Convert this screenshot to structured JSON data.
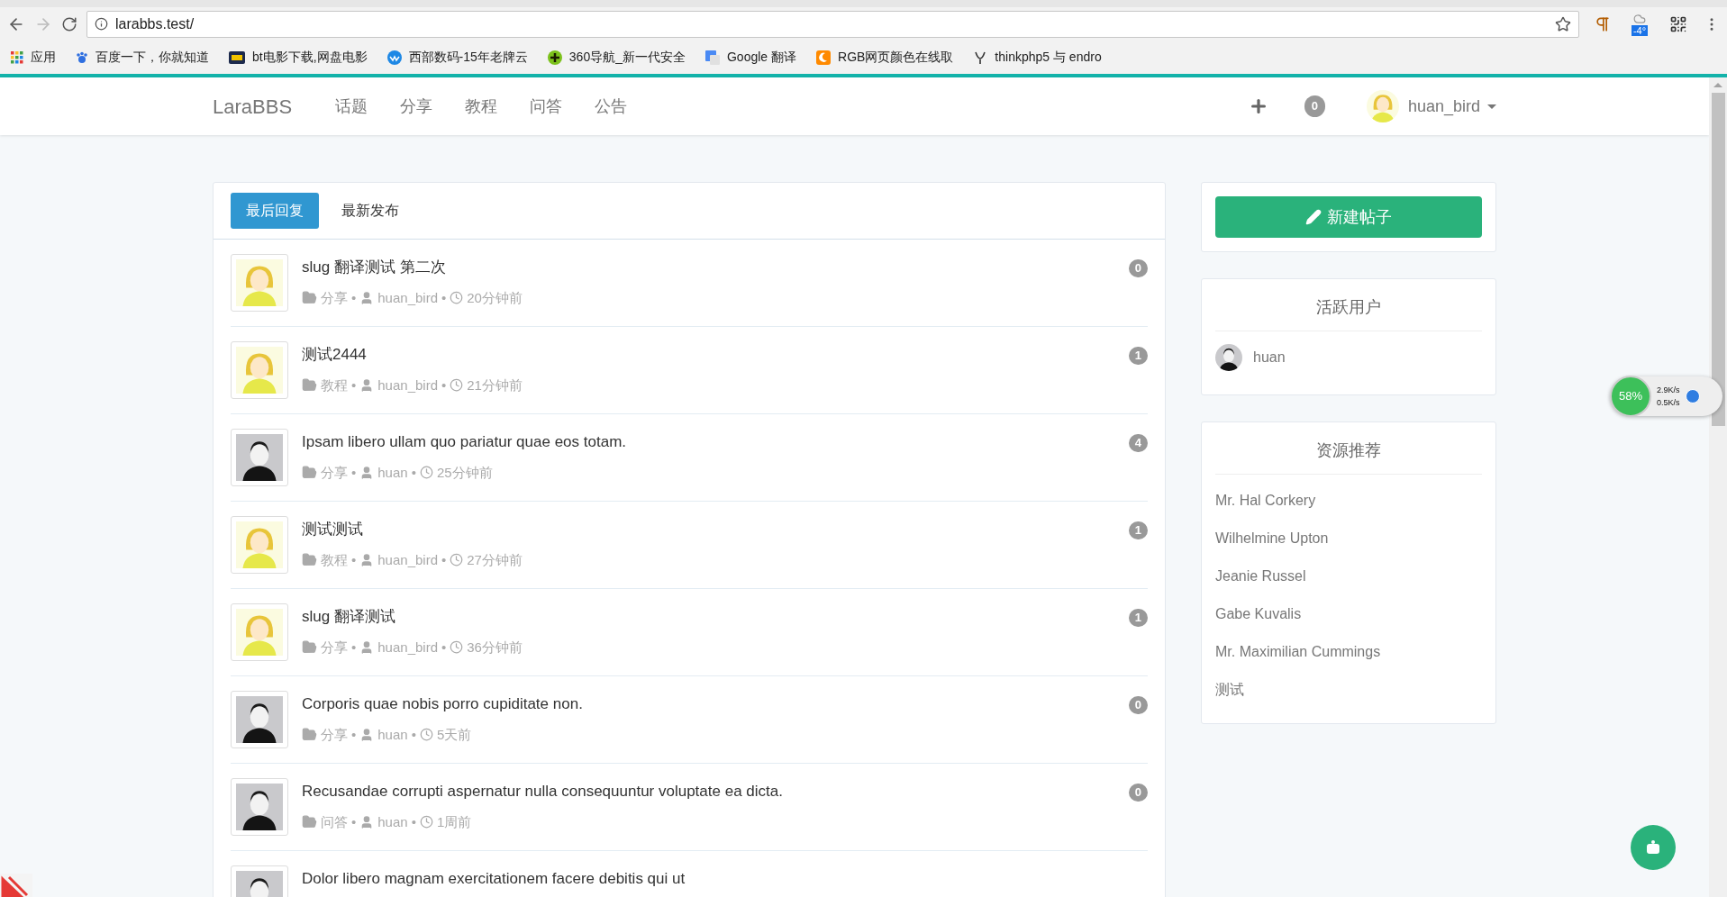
{
  "browser": {
    "address": "larabbs.test/",
    "weather": "-4°",
    "bookmarks": [
      "应用",
      "百度一下，你就知道",
      "bt电影下载,网盘电影",
      "西部数码-15年老牌云",
      "360导航_新一代安全",
      "Google 翻译",
      "RGB网页颜色在线取",
      "thinkphp5 与 endro"
    ]
  },
  "navbar": {
    "brand": "LaraBBS",
    "links": [
      "话题",
      "分享",
      "教程",
      "问答",
      "公告"
    ],
    "notifications": "0",
    "user": "huan_bird"
  },
  "tabs": [
    {
      "label": "最后回复",
      "selected": true
    },
    {
      "label": "最新发布",
      "selected": false
    }
  ],
  "topics": [
    {
      "title": "slug 翻译测试 第二次",
      "category": "分享",
      "author": "huan_bird",
      "time": "20分钟前",
      "replies": "0",
      "kind": "blonde",
      "separators": [
        "•",
        "•"
      ]
    },
    {
      "title": "测试2444",
      "category": "教程",
      "author": "huan_bird",
      "time": "21分钟前",
      "replies": "1",
      "kind": "blonde",
      "separators": [
        "•",
        "•"
      ]
    },
    {
      "title": "Ipsam libero ullam quo pariatur quae eos totam.",
      "category": "分享",
      "author": "huan",
      "time": "25分钟前",
      "replies": "4",
      "kind": "glasses",
      "separators": [
        "•",
        "•"
      ]
    },
    {
      "title": "测试测试",
      "category": "教程",
      "author": "huan_bird",
      "time": "27分钟前",
      "replies": "1",
      "kind": "blonde",
      "separators": [
        "•",
        "•"
      ]
    },
    {
      "title": "slug 翻译测试",
      "category": "分享",
      "author": "huan_bird",
      "time": "36分钟前",
      "replies": "1",
      "kind": "blonde",
      "separators": [
        "•",
        "•"
      ]
    },
    {
      "title": "Corporis quae nobis porro cupiditate non.",
      "category": "分享",
      "author": "huan",
      "time": "5天前",
      "replies": "0",
      "kind": "glasses",
      "separators": [
        "•",
        "•"
      ]
    },
    {
      "title": "Recusandae corrupti aspernatur nulla consequuntur voluptate ea dicta.",
      "category": "问答",
      "author": "huan",
      "time": "1周前",
      "replies": "0",
      "kind": "glasses",
      "separators": [
        "•",
        "•"
      ]
    },
    {
      "title": "Dolor libero magnam exercitationem facere debitis qui ut",
      "kind": "glasses"
    }
  ],
  "sidebar": {
    "new_topic_button": "新建帖子",
    "active_users": {
      "title": "活跃用户",
      "users": [
        {
          "name": "huan",
          "kind": "glasses"
        }
      ]
    },
    "resources": {
      "title": "资源推荐",
      "links": [
        "Mr. Hal Corkery",
        "Wilhelmine Upton",
        "Jeanie Russel",
        "Gabe Kuvalis",
        "Mr. Maximilian Cummings",
        "测试"
      ]
    }
  },
  "speed_widget": {
    "percent": "58%",
    "upload": "2.9K/s",
    "download": "0.5K/s"
  }
}
